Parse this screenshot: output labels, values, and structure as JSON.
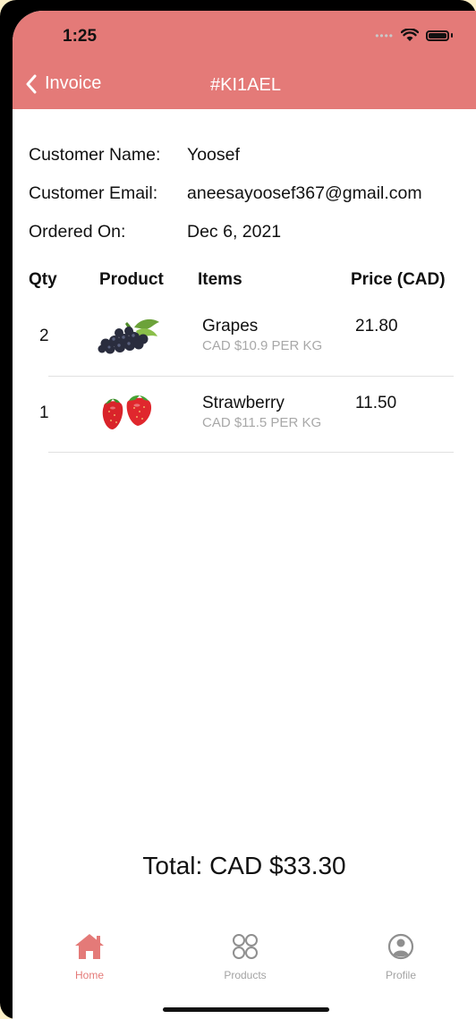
{
  "status": {
    "time": "1:25"
  },
  "nav": {
    "back_label": "Invoice",
    "title": "#KI1AEL"
  },
  "customer": {
    "name_label": "Customer Name:",
    "name_value": "Yoosef",
    "email_label": "Customer Email:",
    "email_value": "aneesayoosef367@gmail.com",
    "ordered_label": "Ordered On:",
    "ordered_value": "Dec 6, 2021"
  },
  "table": {
    "headers": [
      "Qty",
      "Product",
      "Items",
      "Price (CAD)"
    ],
    "rows": [
      {
        "qty": "2",
        "image_icon": "grapes-image",
        "item": "Grapes",
        "unit": "CAD $10.9 PER KG",
        "price": "21.80"
      },
      {
        "qty": "1",
        "image_icon": "strawberry-image",
        "item": "Strawberry",
        "unit": "CAD $11.5 PER KG",
        "price": "11.50"
      }
    ]
  },
  "total": "Total: CAD $33.30",
  "tabbar": {
    "active_color": "#e47a78",
    "inactive_color": "#a3a3a3",
    "items": [
      {
        "label": "Home",
        "icon": "home-icon"
      },
      {
        "label": "Products",
        "icon": "products-icon"
      },
      {
        "label": "Profile",
        "icon": "profile-icon"
      }
    ]
  },
  "colors": {
    "header": "#e47a78"
  }
}
